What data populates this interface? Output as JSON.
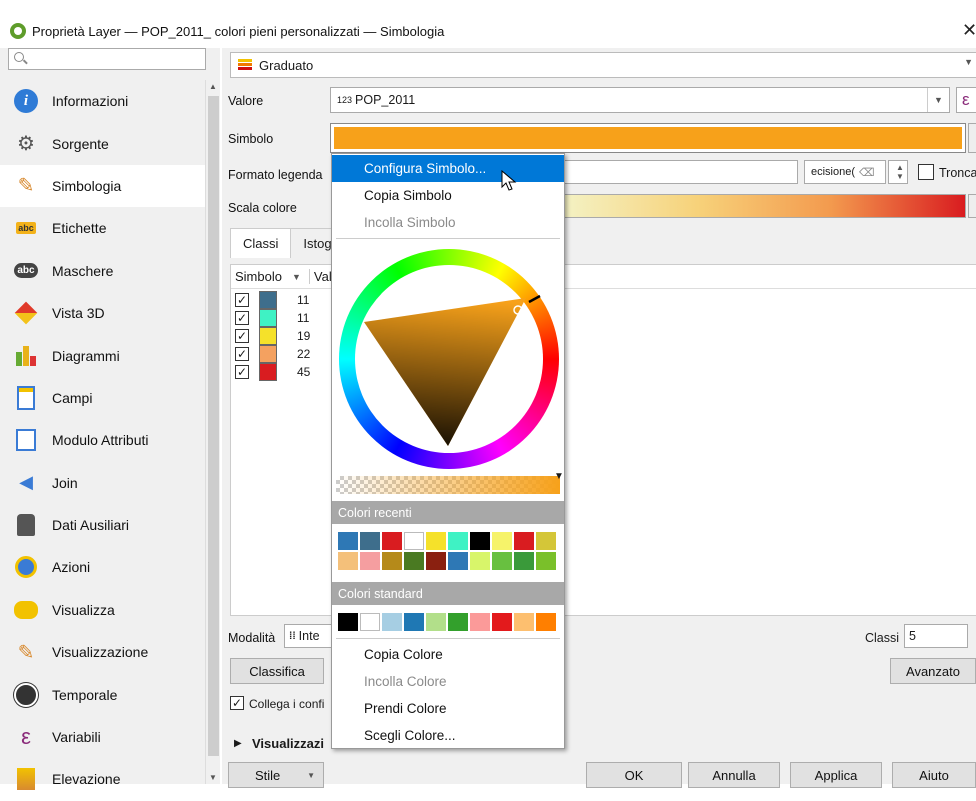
{
  "window": {
    "title": "Proprietà Layer — POP_2011_ colori pieni personalizzati — Simbologia",
    "close": "✕"
  },
  "sidebar": {
    "items": [
      {
        "label": "Informazioni",
        "icon": "info-icon"
      },
      {
        "label": "Sorgente",
        "icon": "source-icon"
      },
      {
        "label": "Simbologia",
        "icon": "symbology-icon"
      },
      {
        "label": "Etichette",
        "icon": "labels-icon"
      },
      {
        "label": "Maschere",
        "icon": "masks-icon"
      },
      {
        "label": "Vista 3D",
        "icon": "3d-view-icon"
      },
      {
        "label": "Diagrammi",
        "icon": "diagrams-icon"
      },
      {
        "label": "Campi",
        "icon": "fields-icon"
      },
      {
        "label": "Modulo Attributi",
        "icon": "attributes-form-icon"
      },
      {
        "label": "Join",
        "icon": "join-icon"
      },
      {
        "label": "Dati Ausiliari",
        "icon": "auxiliary-data-icon"
      },
      {
        "label": "Azioni",
        "icon": "actions-icon"
      },
      {
        "label": "Visualizza",
        "icon": "display-icon"
      },
      {
        "label": "Visualizzazione",
        "icon": "rendering-icon"
      },
      {
        "label": "Temporale",
        "icon": "temporal-icon"
      },
      {
        "label": "Variabili",
        "icon": "variables-icon"
      },
      {
        "label": "Elevazione",
        "icon": "elevation-icon"
      }
    ],
    "active_index": 2
  },
  "main": {
    "renderer": "Graduato",
    "value_label": "Valore",
    "value_field": "POP_2011",
    "value_prefix": "123",
    "expression_icon": "ε",
    "symbol_label": "Simbolo",
    "symbol_color": "#f7a11a",
    "legend_format_label": "Formato legenda",
    "precision_text": "ecisione(",
    "truncate_label": "Tronca",
    "color_ramp_label": "Scala colore",
    "tabs": [
      "Classi",
      "Istog"
    ],
    "class_headers": [
      "Simbolo",
      "Val"
    ],
    "classes": [
      {
        "color": "#3e6e8c",
        "value": "11"
      },
      {
        "color": "#3ff2c4",
        "value": "11"
      },
      {
        "color": "#f5e12a",
        "value": "19"
      },
      {
        "color": "#f4a160",
        "value": "22"
      },
      {
        "color": "#d91c20",
        "value": "45"
      }
    ],
    "mode_label": "Modalità",
    "mode_value": "Inte",
    "classes_label": "Classi",
    "classes_count": "5",
    "classify_button": "Classifica",
    "advanced_button": "Avanzato",
    "link_bounds_label": "Collega i confi",
    "layer_rendering_label": "Visualizzazi",
    "footer": {
      "style": "Stile",
      "ok": "OK",
      "cancel": "Annulla",
      "apply": "Applica",
      "help": "Aiuto"
    }
  },
  "popup_menu": {
    "items_top": [
      {
        "label": "Configura Simbolo...",
        "highlighted": true,
        "disabled": false
      },
      {
        "label": "Copia Simbolo",
        "highlighted": false,
        "disabled": false
      },
      {
        "label": "Incolla Simbolo",
        "highlighted": false,
        "disabled": true
      }
    ],
    "recent_heading": "Colori recenti",
    "recent_colors": [
      "#2e78b5",
      "#3e6e8c",
      "#d91c20",
      "#ffffff",
      "#f5e12a",
      "#3ff2c4",
      "#000000",
      "#f6f36a",
      "#d91c20",
      "#d4c638",
      "#f4c07a",
      "#f59ea0",
      "#b58a1a",
      "#4a7a22",
      "#8a2010",
      "#2e78b5",
      "#d8f56a",
      "#68c040",
      "#3a9a3a",
      "#7ac02a"
    ],
    "standard_heading": "Colori standard",
    "standard_colors": [
      "#000000",
      "#ffffff",
      "#a6cee3",
      "#1f78b4",
      "#b2df8a",
      "#33a02c",
      "#fb9a99",
      "#e31a1c",
      "#fdbf6f",
      "#ff7f00"
    ],
    "items_bottom": [
      {
        "label": "Copia Colore",
        "disabled": false
      },
      {
        "label": "Incolla Colore",
        "disabled": true
      },
      {
        "label": "Prendi Colore",
        "disabled": false
      },
      {
        "label": "Scegli Colore...",
        "disabled": false
      }
    ],
    "current_color": "#f7a11a"
  }
}
